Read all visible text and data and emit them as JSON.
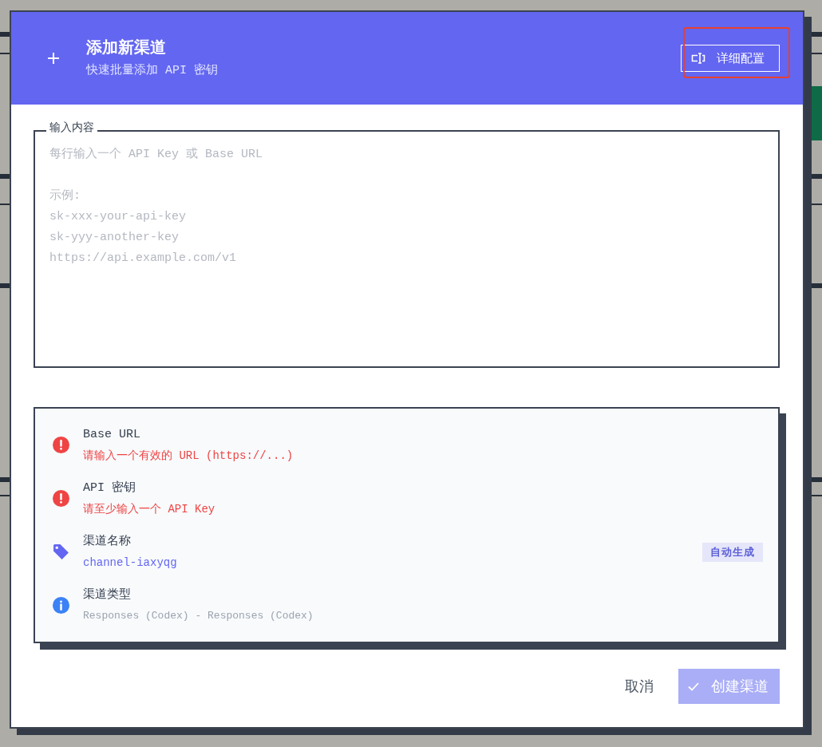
{
  "dialog": {
    "title": "添加新渠道",
    "subtitle": "快速批量添加 API 密钥",
    "config_button": {
      "label": "详细配置",
      "highlighted": true
    }
  },
  "input": {
    "legend": "输入内容",
    "placeholder": "每行输入一个 API Key 或 Base URL\n\n示例:\nsk-xxx-your-api-key\nsk-yyy-another-key\nhttps://api.example.com/v1"
  },
  "summary": {
    "rows": [
      {
        "kind": "error",
        "label": "Base URL",
        "message": "请输入一个有效的 URL (https://...)"
      },
      {
        "kind": "error",
        "label": "API 密钥",
        "message": "请至少输入一个 API Key"
      },
      {
        "kind": "name",
        "label": "渠道名称",
        "value": "channel-iaxyqg",
        "badge": "自动生成"
      },
      {
        "kind": "info",
        "label": "渠道类型",
        "value": "Responses (Codex) - Responses (Codex)"
      }
    ]
  },
  "footer": {
    "cancel": "取消",
    "create": {
      "label": "创建渠道",
      "disabled": true
    }
  }
}
